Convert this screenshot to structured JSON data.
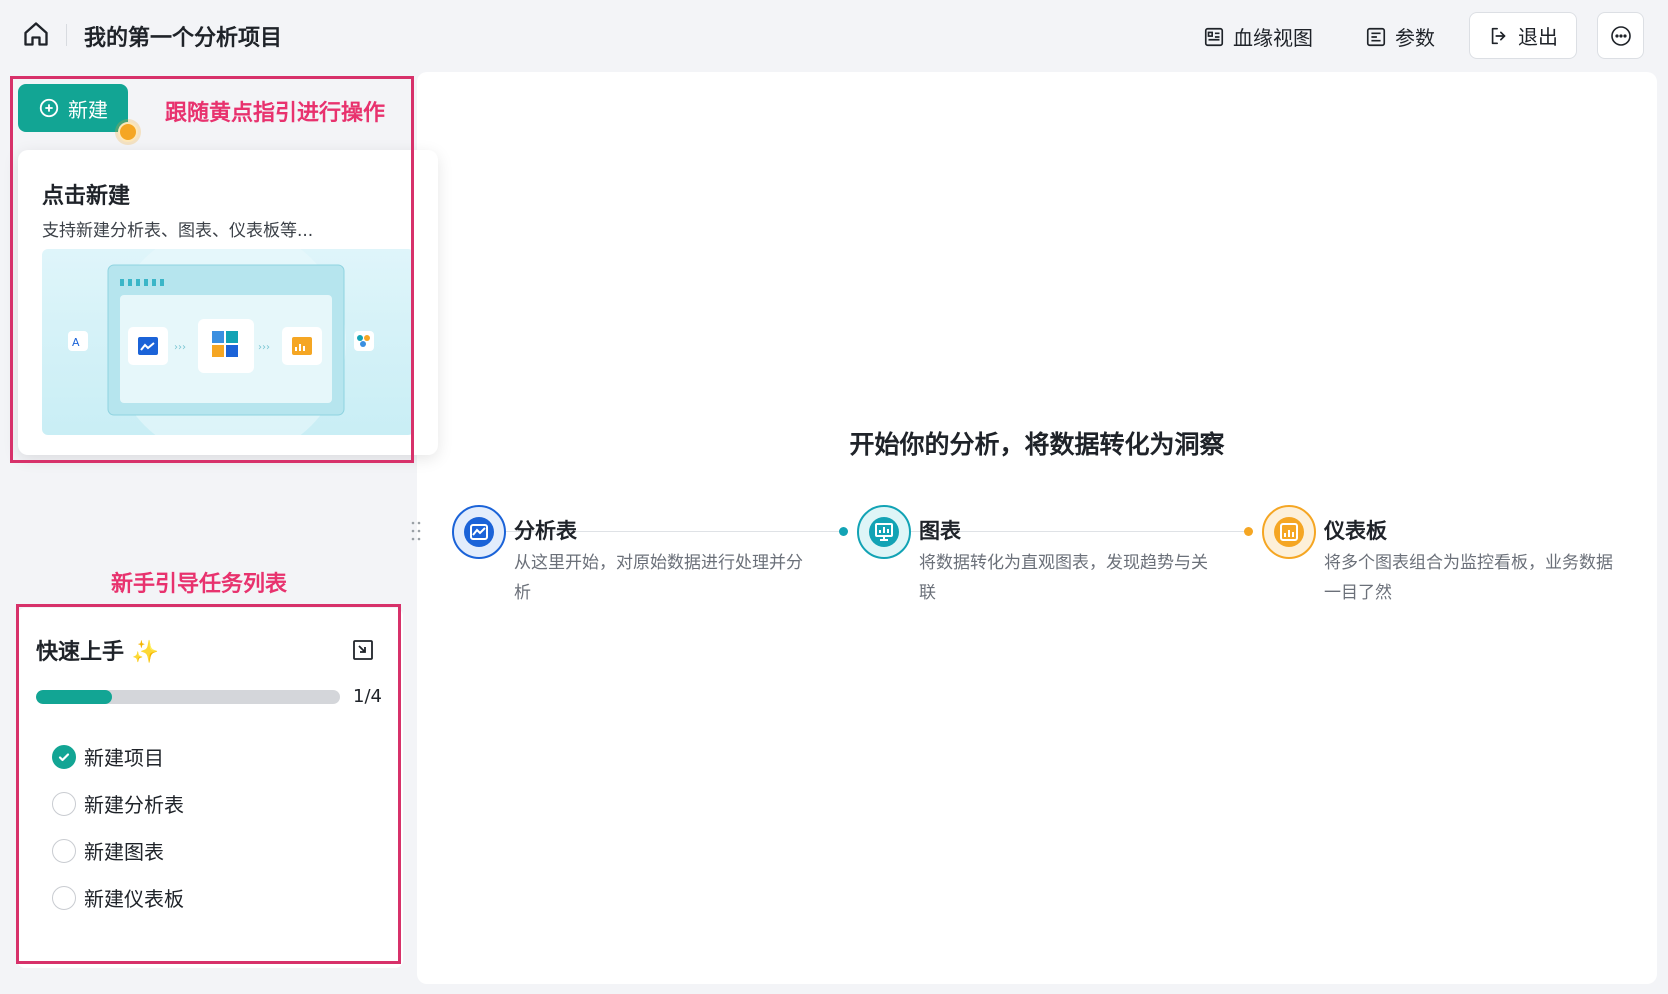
{
  "header": {
    "project_title": "我的第一个分析项目",
    "lineage_label": "血缘视图",
    "params_label": "参数",
    "exit_label": "退出"
  },
  "sidebar": {
    "new_button_label": "新建",
    "annotation_follow": "跟随黄点指引进行操作",
    "annotation_tasks": "新手引导任务列表",
    "tip": {
      "title": "点击新建",
      "description": "支持新建分析表、图表、仪表板等..."
    },
    "quick_start": {
      "title": "快速上手",
      "progress_text": "1/4",
      "progress_fraction": 0.25,
      "tasks": [
        {
          "label": "新建项目",
          "done": true
        },
        {
          "label": "新建分析表",
          "done": false
        },
        {
          "label": "新建图表",
          "done": false
        },
        {
          "label": "新建仪表板",
          "done": false
        }
      ]
    }
  },
  "main": {
    "hero_title": "开始你的分析，将数据转化为洞察",
    "steps": [
      {
        "title": "分析表",
        "description": "从这里开始，对原始数据进行处理并分析",
        "color": "#1b63d8"
      },
      {
        "title": "图表",
        "description": "将数据转化为直观图表，发现趋势与关联",
        "color": "#12a3b5"
      },
      {
        "title": "仪表板",
        "description": "将多个图表组合为监控看板，业务数据一目了然",
        "color": "#f5a623"
      }
    ]
  },
  "colors": {
    "brand": "#12a594",
    "annotation": "#d7316a",
    "guide_dot": "#f5a623"
  }
}
